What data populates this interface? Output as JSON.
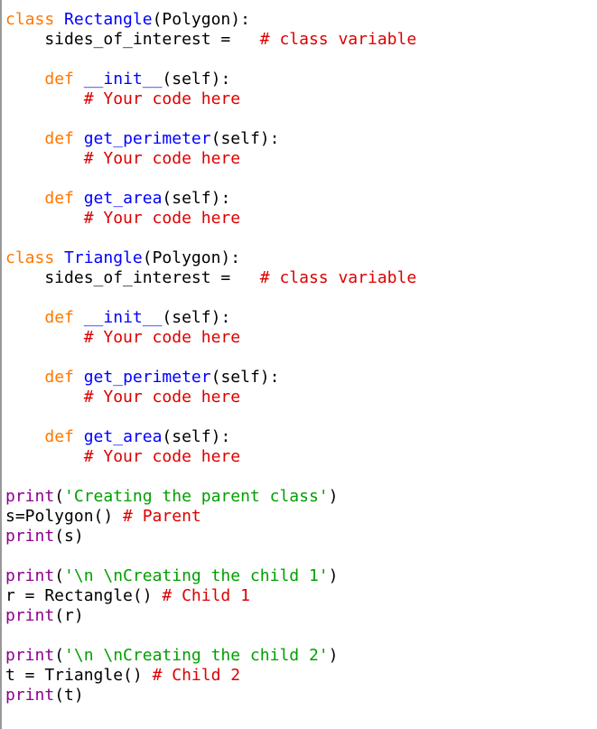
{
  "document": {
    "kind": "python-source-listing",
    "language": "Python",
    "background_color": "#ffffff",
    "left_border_color": "#999999"
  },
  "theme": {
    "keyword_color": "#ff7700",
    "definition_color": "#0000ff",
    "builtin_color": "#900090",
    "string_color": "#00a000",
    "comment_color": "#dd0000",
    "plain_color": "#000000"
  },
  "code": {
    "line_count": 30,
    "lines": [
      {
        "n": 1,
        "tokens": [
          {
            "t": "class ",
            "c": "kw"
          },
          {
            "t": "Rectangle",
            "c": "def"
          },
          {
            "t": "(Polygon):",
            "c": "plain"
          }
        ]
      },
      {
        "n": 2,
        "tokens": [
          {
            "t": "    sides_of_interest =   ",
            "c": "plain"
          },
          {
            "t": "# class variable",
            "c": "com"
          }
        ]
      },
      {
        "n": 3,
        "tokens": []
      },
      {
        "n": 4,
        "tokens": [
          {
            "t": "    ",
            "c": "plain"
          },
          {
            "t": "def ",
            "c": "kw"
          },
          {
            "t": "__init__",
            "c": "def"
          },
          {
            "t": "(self):",
            "c": "plain"
          }
        ]
      },
      {
        "n": 5,
        "tokens": [
          {
            "t": "        ",
            "c": "plain"
          },
          {
            "t": "# Your code here",
            "c": "com"
          }
        ]
      },
      {
        "n": 6,
        "tokens": []
      },
      {
        "n": 7,
        "tokens": [
          {
            "t": "    ",
            "c": "plain"
          },
          {
            "t": "def ",
            "c": "kw"
          },
          {
            "t": "get_perimeter",
            "c": "def"
          },
          {
            "t": "(self):",
            "c": "plain"
          }
        ]
      },
      {
        "n": 8,
        "tokens": [
          {
            "t": "        ",
            "c": "plain"
          },
          {
            "t": "# Your code here",
            "c": "com"
          }
        ]
      },
      {
        "n": 9,
        "tokens": []
      },
      {
        "n": 10,
        "tokens": [
          {
            "t": "    ",
            "c": "plain"
          },
          {
            "t": "def ",
            "c": "kw"
          },
          {
            "t": "get_area",
            "c": "def"
          },
          {
            "t": "(self):",
            "c": "plain"
          }
        ]
      },
      {
        "n": 11,
        "tokens": [
          {
            "t": "        ",
            "c": "plain"
          },
          {
            "t": "# Your code here",
            "c": "com"
          }
        ]
      },
      {
        "n": 12,
        "tokens": []
      },
      {
        "n": 13,
        "tokens": [
          {
            "t": "class ",
            "c": "kw"
          },
          {
            "t": "Triangle",
            "c": "def"
          },
          {
            "t": "(Polygon):",
            "c": "plain"
          }
        ]
      },
      {
        "n": 14,
        "tokens": [
          {
            "t": "    sides_of_interest =   ",
            "c": "plain"
          },
          {
            "t": "# class variable",
            "c": "com"
          }
        ]
      },
      {
        "n": 15,
        "tokens": []
      },
      {
        "n": 16,
        "tokens": [
          {
            "t": "    ",
            "c": "plain"
          },
          {
            "t": "def ",
            "c": "kw"
          },
          {
            "t": "__init__",
            "c": "def"
          },
          {
            "t": "(self):",
            "c": "plain"
          }
        ]
      },
      {
        "n": 17,
        "tokens": [
          {
            "t": "        ",
            "c": "plain"
          },
          {
            "t": "# Your code here",
            "c": "com"
          }
        ]
      },
      {
        "n": 18,
        "tokens": []
      },
      {
        "n": 19,
        "tokens": [
          {
            "t": "    ",
            "c": "plain"
          },
          {
            "t": "def ",
            "c": "kw"
          },
          {
            "t": "get_perimeter",
            "c": "def"
          },
          {
            "t": "(self):",
            "c": "plain"
          }
        ]
      },
      {
        "n": 20,
        "tokens": [
          {
            "t": "        ",
            "c": "plain"
          },
          {
            "t": "# Your code here",
            "c": "com"
          }
        ]
      },
      {
        "n": 21,
        "tokens": []
      },
      {
        "n": 22,
        "tokens": [
          {
            "t": "    ",
            "c": "plain"
          },
          {
            "t": "def ",
            "c": "kw"
          },
          {
            "t": "get_area",
            "c": "def"
          },
          {
            "t": "(self):",
            "c": "plain"
          }
        ]
      },
      {
        "n": 23,
        "tokens": [
          {
            "t": "        ",
            "c": "plain"
          },
          {
            "t": "# Your code here",
            "c": "com"
          }
        ]
      },
      {
        "n": 24,
        "tokens": []
      },
      {
        "n": 25,
        "tokens": [
          {
            "t": "print",
            "c": "builtin"
          },
          {
            "t": "(",
            "c": "plain"
          },
          {
            "t": "'Creating the parent class'",
            "c": "str"
          },
          {
            "t": ")",
            "c": "plain"
          }
        ]
      },
      {
        "n": 26,
        "tokens": [
          {
            "t": "s=Polygon() ",
            "c": "plain"
          },
          {
            "t": "# Parent",
            "c": "com"
          }
        ]
      },
      {
        "n": 27,
        "tokens": [
          {
            "t": "print",
            "c": "builtin"
          },
          {
            "t": "(s)",
            "c": "plain"
          }
        ]
      },
      {
        "n": 28,
        "tokens": []
      },
      {
        "n": 29,
        "tokens": [
          {
            "t": "print",
            "c": "builtin"
          },
          {
            "t": "(",
            "c": "plain"
          },
          {
            "t": "'\\n \\nCreating the child 1'",
            "c": "str"
          },
          {
            "t": ")",
            "c": "plain"
          }
        ]
      },
      {
        "n": 30,
        "tokens": [
          {
            "t": "r = Rectangle() ",
            "c": "plain"
          },
          {
            "t": "# Child 1",
            "c": "com"
          }
        ]
      },
      {
        "n": 31,
        "tokens": [
          {
            "t": "print",
            "c": "builtin"
          },
          {
            "t": "(r)",
            "c": "plain"
          }
        ]
      },
      {
        "n": 32,
        "tokens": []
      },
      {
        "n": 33,
        "tokens": [
          {
            "t": "print",
            "c": "builtin"
          },
          {
            "t": "(",
            "c": "plain"
          },
          {
            "t": "'\\n \\nCreating the child 2'",
            "c": "str"
          },
          {
            "t": ")",
            "c": "plain"
          }
        ]
      },
      {
        "n": 34,
        "tokens": [
          {
            "t": "t = Triangle() ",
            "c": "plain"
          },
          {
            "t": "# Child 2",
            "c": "com"
          }
        ]
      },
      {
        "n": 35,
        "tokens": [
          {
            "t": "print",
            "c": "builtin"
          },
          {
            "t": "(t)",
            "c": "plain"
          }
        ]
      }
    ]
  }
}
